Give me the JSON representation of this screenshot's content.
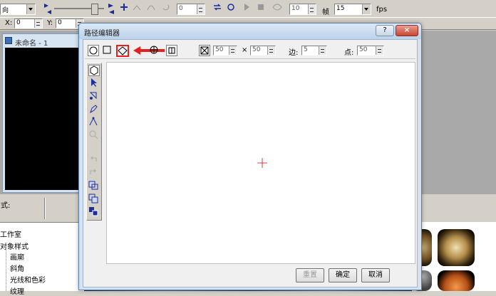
{
  "toolbar": {
    "dropdown_value": "向",
    "field_value_1": "0",
    "field_value_2": "10",
    "frames_label": "帧",
    "fps_value": "15",
    "fps_unit": "fps"
  },
  "coords": {
    "x_label": "X:",
    "x_value": "0",
    "y_label": "Y:",
    "y_value": "0"
  },
  "doc_window": {
    "title": "未命名 - 1"
  },
  "left_strip": {
    "style_label": "式:"
  },
  "panel": {
    "items": [
      "工作室",
      "对象样式",
      "画廓",
      "斜角",
      "光线和色彩",
      "纹理"
    ]
  },
  "dialog": {
    "title": "路径编辑器",
    "help": "?",
    "close": "×",
    "grid_w": "50",
    "grid_x": "×",
    "grid_h": "50",
    "sides_label": "边:",
    "sides_value": "5",
    "points_label": "点:",
    "points_value": "50",
    "buttons": {
      "reset": "重置",
      "ok": "确定",
      "cancel": "取消"
    }
  },
  "colors": {
    "highlight": "#e52020",
    "dialog_title_bg": "#bcd3ea"
  }
}
